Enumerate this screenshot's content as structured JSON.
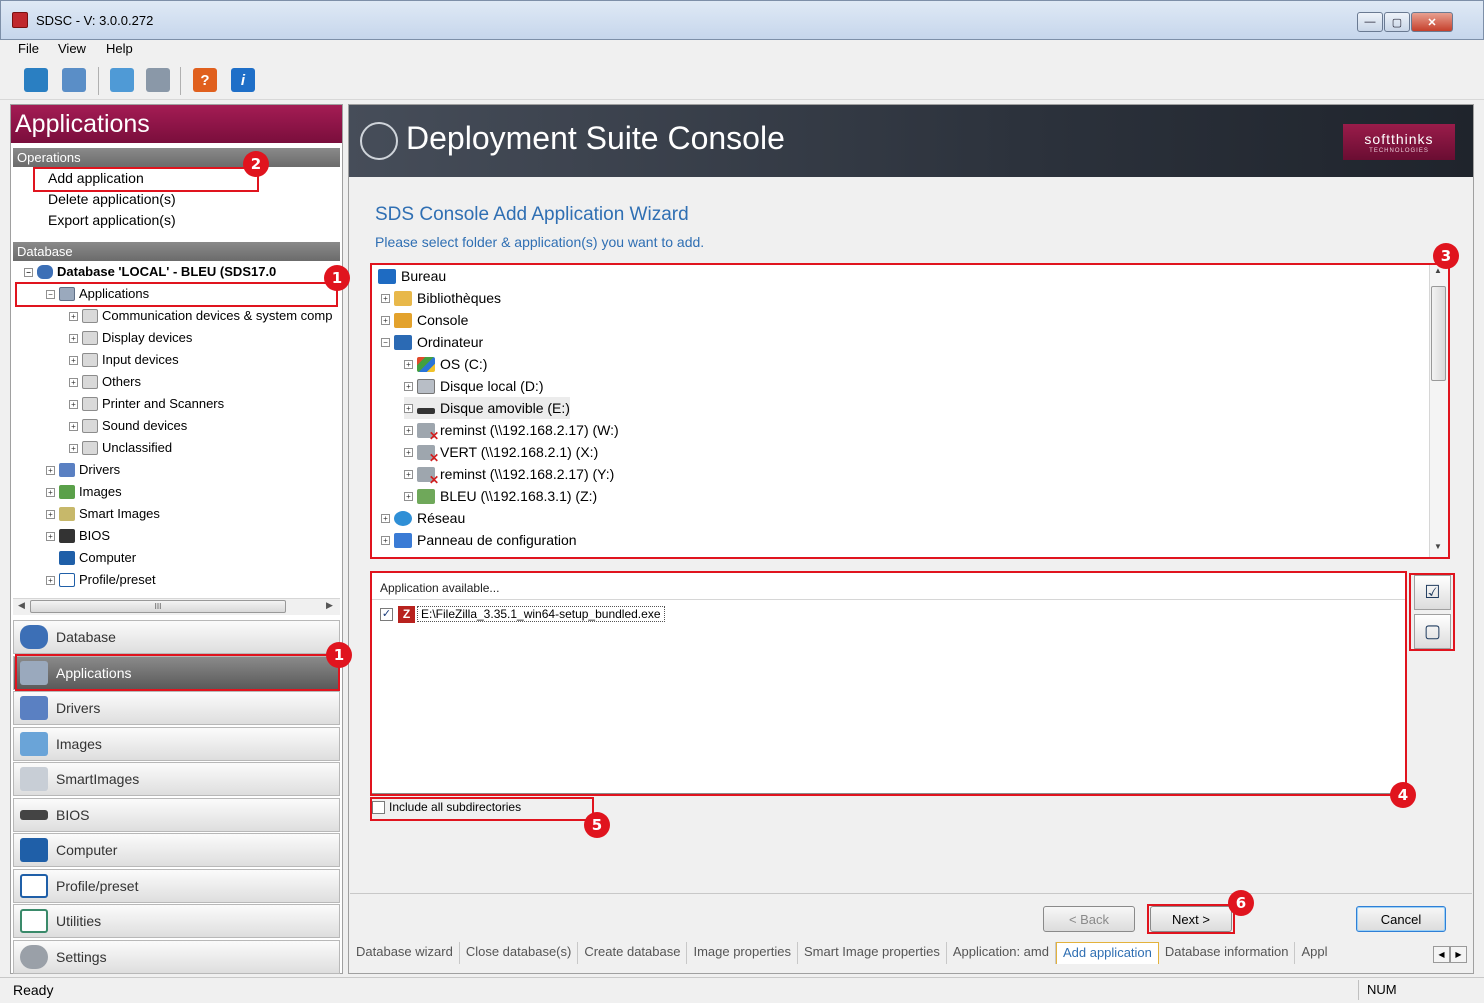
{
  "window": {
    "title": "SDSC - V: 3.0.0.272",
    "min": "—",
    "max": "▢",
    "close": "✕"
  },
  "menu": {
    "file": "File",
    "view": "View",
    "help": "Help"
  },
  "toolbar": {
    "help_glyph": "?",
    "info_glyph": "i"
  },
  "left": {
    "header": "Applications",
    "operations_label": "Operations",
    "operations": [
      "Add application",
      "Delete application(s)",
      "Export application(s)"
    ],
    "database_label": "Database",
    "db_root": "Database 'LOCAL' - BLEU (SDS17.0",
    "apps_node": "Applications",
    "app_categories": [
      "Communication devices & system comp",
      "Display devices",
      "Input devices",
      "Others",
      "Printer and Scanners",
      "Sound devices",
      "Unclassified"
    ],
    "other_nodes": [
      "Drivers",
      "Images",
      "Smart Images",
      "BIOS",
      "Computer",
      "Profile/preset"
    ],
    "hscroll_glyph": "III"
  },
  "nav": [
    "Database",
    "Applications",
    "Drivers",
    "Images",
    "SmartImages",
    "BIOS",
    "Computer",
    "Profile/preset",
    "Utilities",
    "Settings"
  ],
  "banner": {
    "title": "Deployment Suite Console",
    "brand": "softthinks",
    "brand_sub": "TECHNOLOGIES"
  },
  "wizard": {
    "title": "SDS Console Add Application Wizard",
    "subtitle": "Please select folder & application(s) you want to add.",
    "folders": {
      "root": "Bureau",
      "lib": "Bibliothèques",
      "console": "Console",
      "computer": "Ordinateur",
      "drives": [
        "OS (C:)",
        "Disque local (D:)",
        "Disque amovible (E:)",
        "reminst (\\\\192.168.2.17) (W:)",
        "VERT (\\\\192.168.2.1) (X:)",
        "reminst (\\\\192.168.2.17) (Y:)",
        "BLEU (\\\\192.168.3.1) (Z:)"
      ],
      "network": "Réseau",
      "control_panel": "Panneau de configuration"
    },
    "app_list_header": "Application available...",
    "app_item": "E:\\FileZilla_3.35.1_win64-setup_bundled.exe",
    "app_icon_glyph": "Z",
    "include_subdirs": "Include all subdirectories",
    "back_label": "< Back",
    "next_label": "Next >",
    "cancel_label": "Cancel"
  },
  "tabs": [
    "Database wizard",
    "Close database(s)",
    "Create database",
    "Image properties",
    "Smart Image properties",
    "Application: amd",
    "Add application",
    "Database information",
    "Appl"
  ],
  "status": {
    "text": "Ready",
    "num": "NUM"
  },
  "annotations": [
    "1",
    "2",
    "1",
    "3",
    "4",
    "5",
    "6"
  ],
  "colors": {
    "accent": "#a41c54",
    "wizard_blue": "#2f6fb3",
    "callout_red": "#e0141e"
  }
}
